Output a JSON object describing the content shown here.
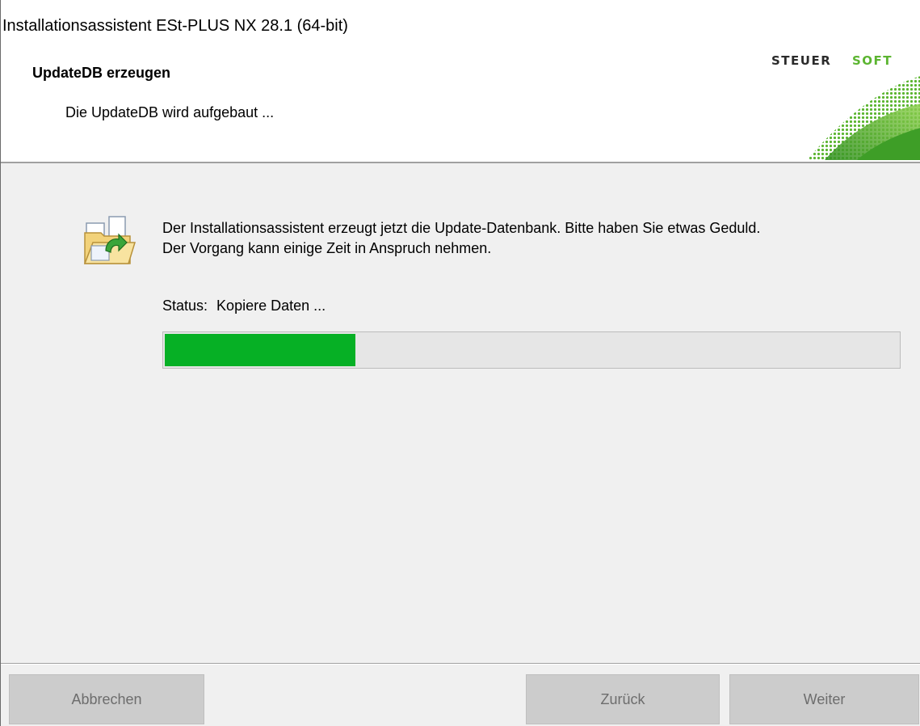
{
  "window": {
    "title": "Installationsassistent ESt-PLUS NX 28.1 (64-bit)"
  },
  "header": {
    "title": "UpdateDB erzeugen",
    "subtitle": "Die UpdateDB wird aufgebaut ...",
    "logo_text": "STEUERSOFT",
    "logo_colors": {
      "dark": "#2b2b2b",
      "green": "#5cb531"
    }
  },
  "content": {
    "icon": "folder-update-icon",
    "message_line1": "Der Installationsassistent erzeugt jetzt die Update-Datenbank. Bitte haben Sie etwas Geduld.",
    "message_line2": "Der Vorgang kann einige Zeit in Anspruch nehmen.",
    "status_label": "Status:",
    "status_value": "Kopiere Daten ...",
    "progress_percent": 26,
    "progress_color": "#06b025"
  },
  "footer": {
    "cancel_label": "Abbrechen",
    "back_label": "Zurück",
    "next_label": "Weiter"
  }
}
